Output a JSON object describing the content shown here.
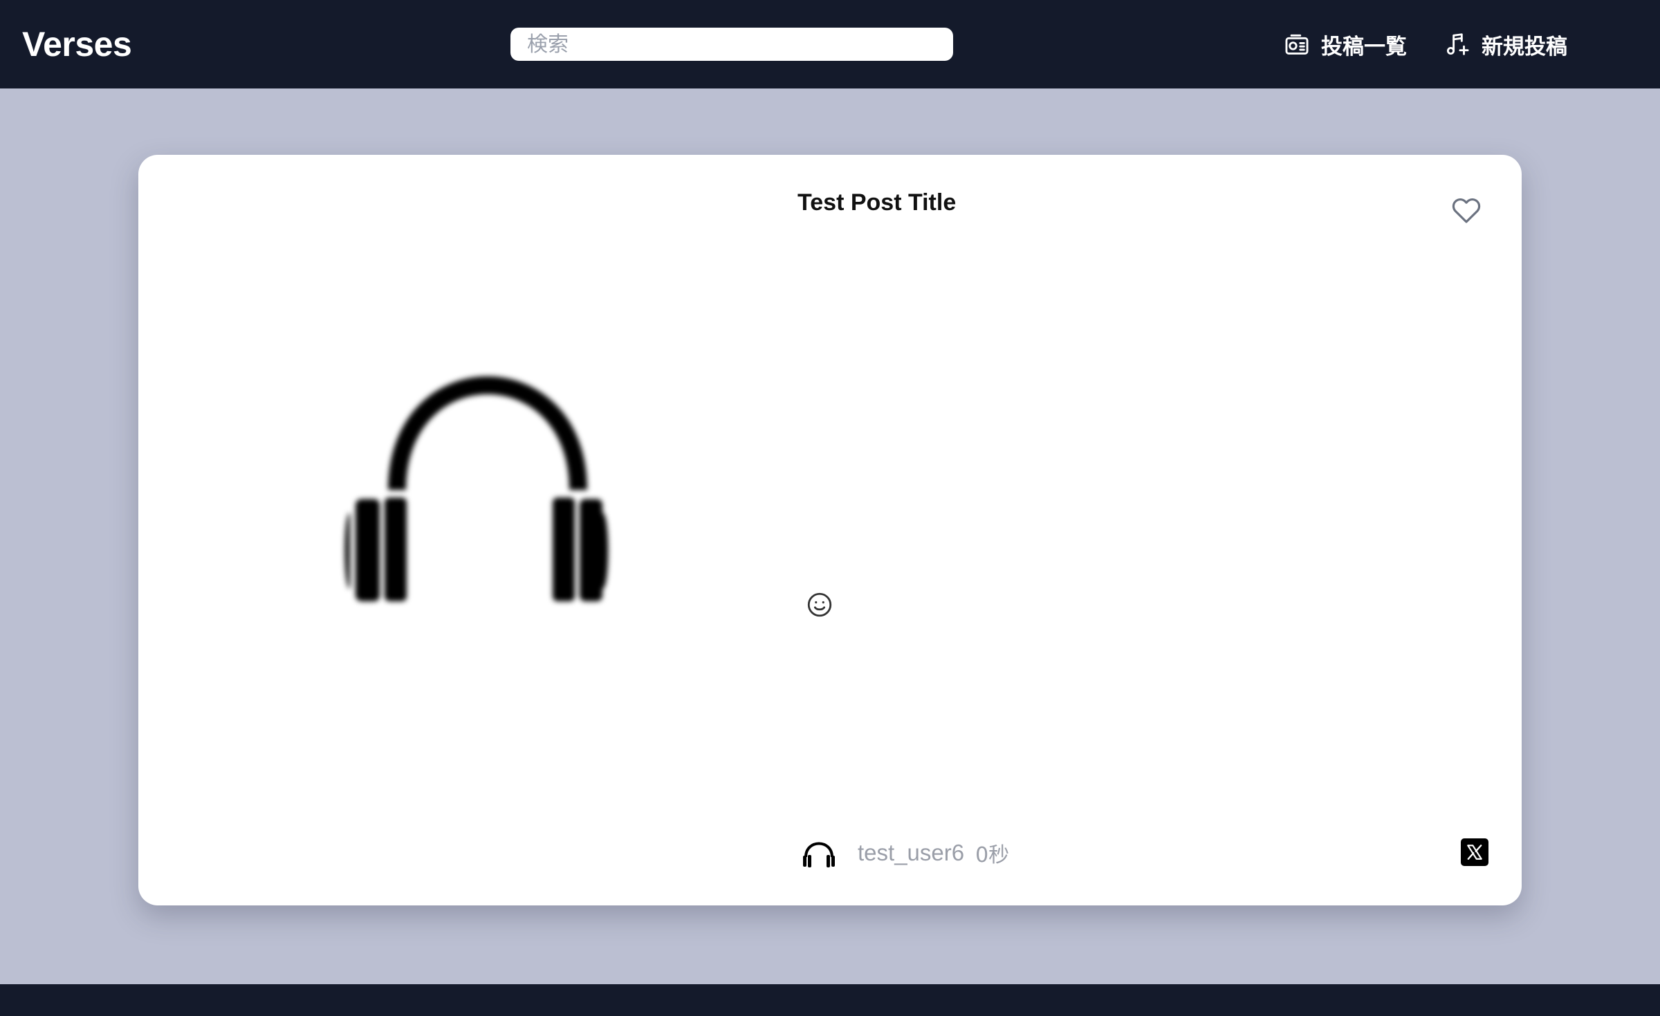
{
  "app": {
    "brand": "Verses"
  },
  "search": {
    "placeholder": "検索",
    "value": ""
  },
  "nav": {
    "posts_label": "投稿一覧",
    "new_post_label": "新規投稿"
  },
  "post": {
    "title": "Test Post Title",
    "cover_icon": "headphones-icon",
    "liked": false,
    "author": {
      "username": "test_user6",
      "avatar_icon": "headphones-icon"
    },
    "timestamp": "0秒"
  },
  "colors": {
    "navbar_bg": "#141a2b",
    "page_bg": "#bbbfd2",
    "card_bg": "#ffffff",
    "muted_text": "#9a9ea8"
  }
}
